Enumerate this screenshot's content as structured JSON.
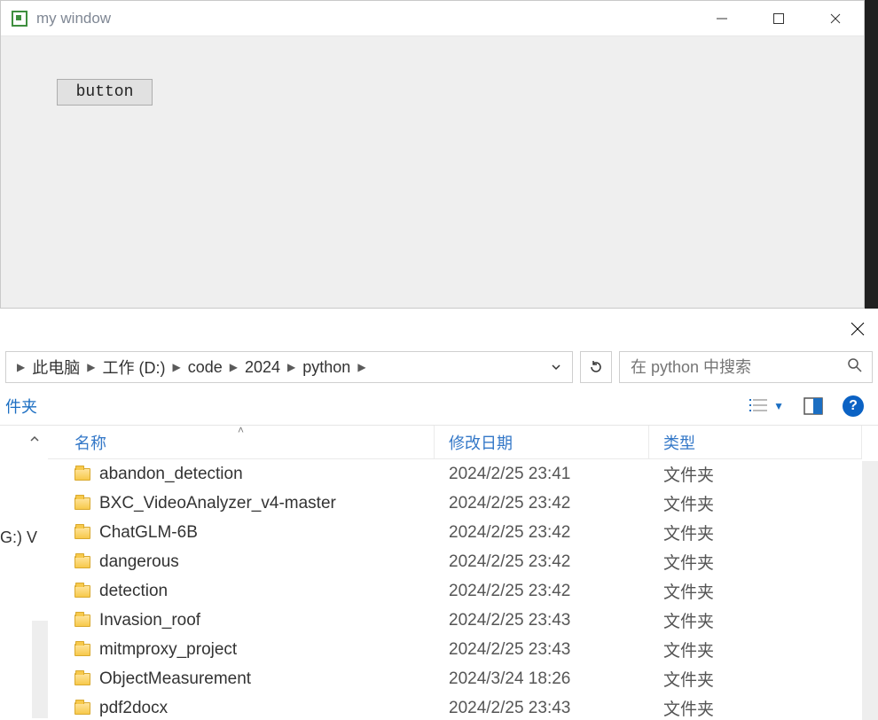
{
  "app_window": {
    "title": "my window",
    "button_label": "button"
  },
  "explorer": {
    "breadcrumb": [
      "此电脑",
      "工作 (D:)",
      "code",
      "2024",
      "python"
    ],
    "search_placeholder": "在 python 中搜索",
    "new_folder_label": "件夹",
    "left_fragment": "G:) V",
    "columns": {
      "name": "名称",
      "date": "修改日期",
      "type": "类型"
    },
    "rows": [
      {
        "name": "abandon_detection",
        "date": "2024/2/25 23:41",
        "type": "文件夹"
      },
      {
        "name": "BXC_VideoAnalyzer_v4-master",
        "date": "2024/2/25 23:42",
        "type": "文件夹"
      },
      {
        "name": "ChatGLM-6B",
        "date": "2024/2/25 23:42",
        "type": "文件夹"
      },
      {
        "name": "dangerous",
        "date": "2024/2/25 23:42",
        "type": "文件夹"
      },
      {
        "name": "detection",
        "date": "2024/2/25 23:42",
        "type": "文件夹"
      },
      {
        "name": "Invasion_roof",
        "date": "2024/2/25 23:43",
        "type": "文件夹"
      },
      {
        "name": "mitmproxy_project",
        "date": "2024/2/25 23:43",
        "type": "文件夹"
      },
      {
        "name": "ObjectMeasurement",
        "date": "2024/3/24 18:26",
        "type": "文件夹"
      },
      {
        "name": "pdf2docx",
        "date": "2024/2/25 23:43",
        "type": "文件夹"
      }
    ]
  }
}
